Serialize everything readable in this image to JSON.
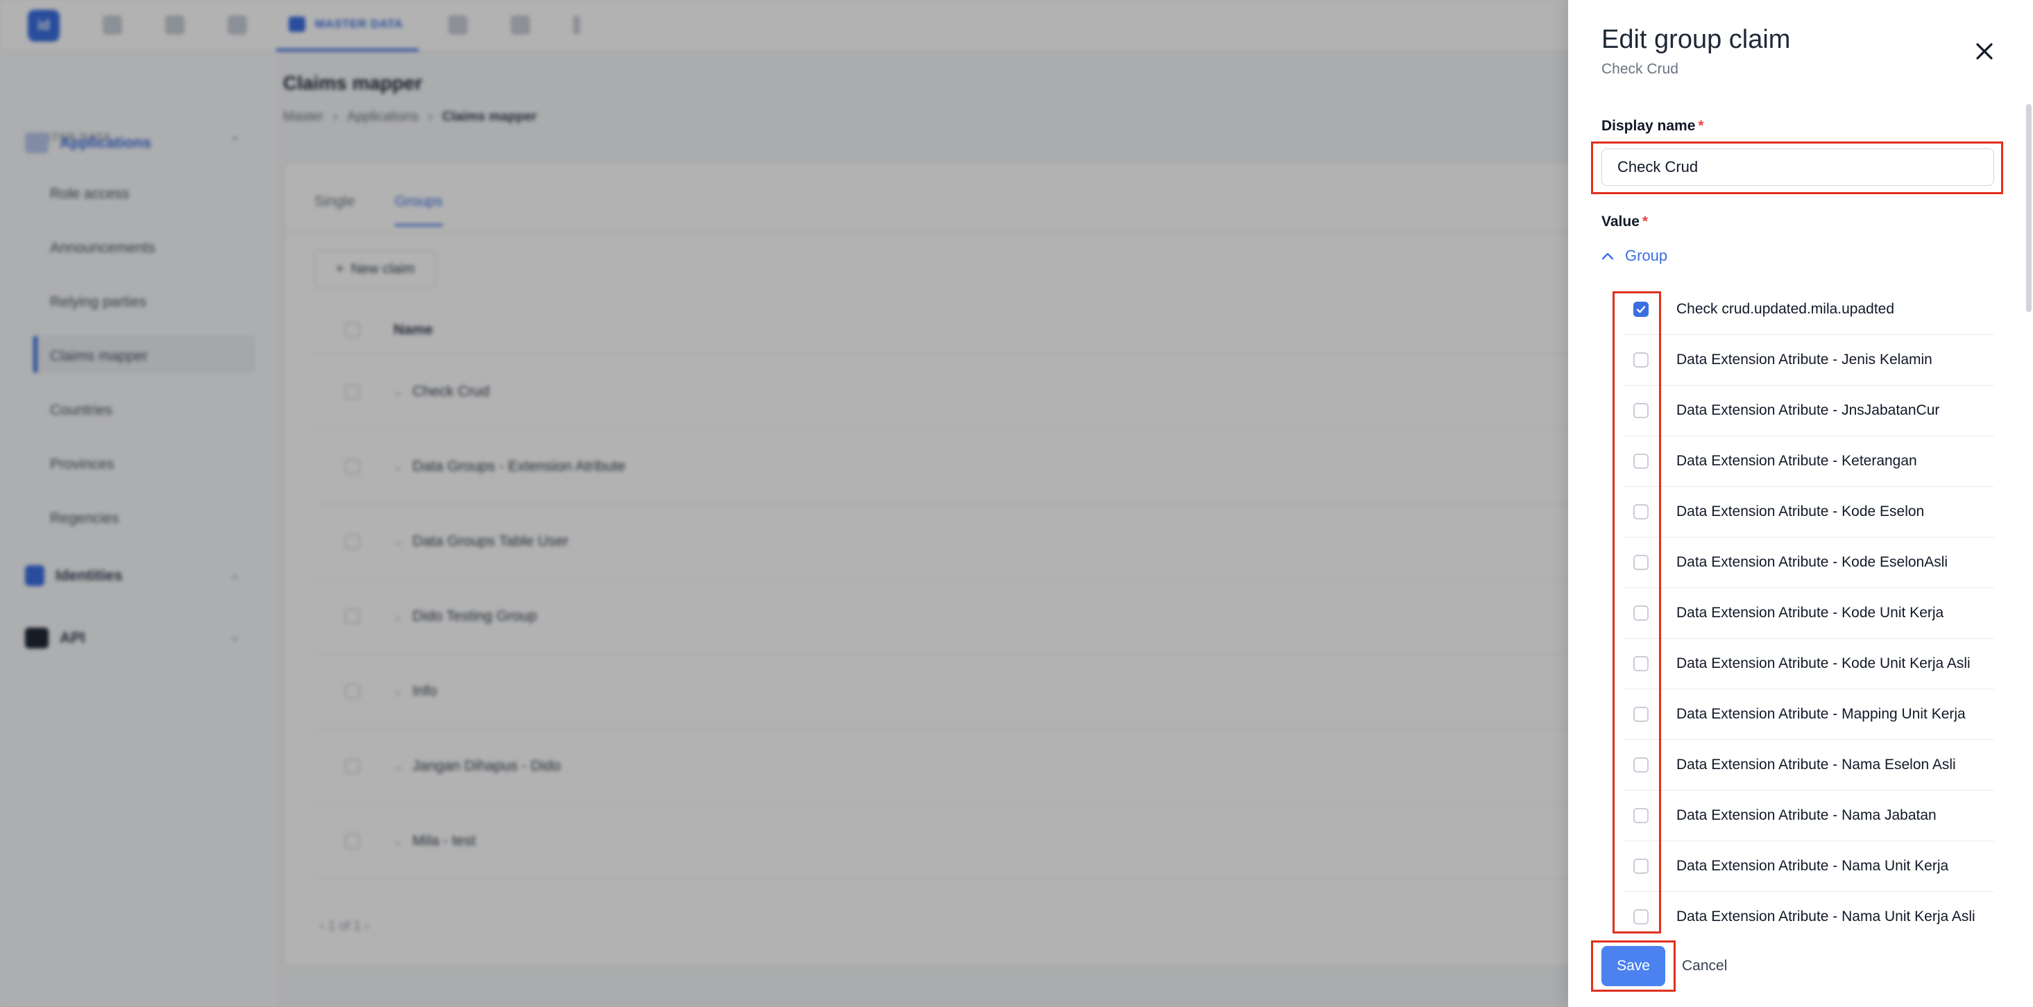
{
  "app": {
    "logo_text": "id",
    "top_tab_label": "MASTER DATA"
  },
  "sidebar": {
    "section_label": "MASTER DATA",
    "groups": [
      {
        "label": "Applications",
        "icon": "applications-icon",
        "items": [
          "Role access",
          "Announcements",
          "Relying parties",
          "Claims mapper",
          "Countries",
          "Provinces",
          "Regencies"
        ]
      },
      {
        "label": "Identities",
        "icon": "shield-icon"
      },
      {
        "label": "API",
        "icon": "api-icon"
      }
    ]
  },
  "main": {
    "title": "Claims mapper",
    "breadcrumb": [
      "Master",
      "Applications",
      "Claims mapper"
    ],
    "tabs": [
      "Single",
      "Groups"
    ],
    "new_claim_label": "New claim",
    "column_name": "Name",
    "rows": [
      "Check Crud",
      "Data Groups - Extension Atribute",
      "Data Groups Table User",
      "Dido Testing Group",
      "Info",
      "Jangan Dihapus - Dido",
      "Mila - test"
    ],
    "pager": "1 of 1"
  },
  "drawer": {
    "title": "Edit group claim",
    "subtitle": "Check Crud",
    "display_name_label": "Display name",
    "display_name_value": "Check Crud",
    "value_label": "Value",
    "group_toggle_label": "Group",
    "items": [
      {
        "label": "Check crud.updated.mila.upadted",
        "checked": true
      },
      {
        "label": "Data Extension Atribute - Jenis Kelamin",
        "checked": false
      },
      {
        "label": "Data Extension Atribute - JnsJabatanCur",
        "checked": false
      },
      {
        "label": "Data Extension Atribute - Keterangan",
        "checked": false
      },
      {
        "label": "Data Extension Atribute - Kode Eselon",
        "checked": false
      },
      {
        "label": "Data Extension Atribute - Kode EselonAsli",
        "checked": false
      },
      {
        "label": "Data Extension Atribute - Kode Unit Kerja",
        "checked": false
      },
      {
        "label": "Data Extension Atribute - Kode Unit Kerja Asli",
        "checked": false
      },
      {
        "label": "Data Extension Atribute - Mapping Unit Kerja",
        "checked": false
      },
      {
        "label": "Data Extension Atribute - Nama Eselon Asli",
        "checked": false
      },
      {
        "label": "Data Extension Atribute - Nama Jabatan",
        "checked": false
      },
      {
        "label": "Data Extension Atribute - Nama Unit Kerja",
        "checked": false
      },
      {
        "label": "Data Extension Atribute - Nama Unit Kerja Asli",
        "checked": false
      }
    ],
    "save_label": "Save",
    "cancel_label": "Cancel"
  },
  "colors": {
    "accent": "#3b6fe0",
    "save_button": "#4b82f0",
    "required": "#ef4444",
    "highlight": "#e0301e"
  }
}
